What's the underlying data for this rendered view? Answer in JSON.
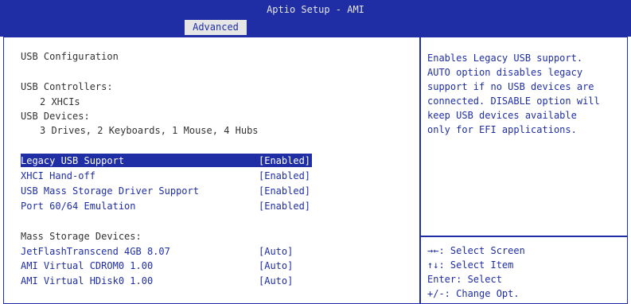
{
  "app": {
    "title": "Aptio Setup - AMI",
    "active_tab": "Advanced"
  },
  "main": {
    "section_title": "USB Configuration",
    "controllers_label": "USB Controllers:",
    "controllers_value": "2 XHCIs",
    "devices_label": "USB Devices:",
    "devices_value": "3 Drives, 2 Keyboards, 1 Mouse, 4 Hubs",
    "settings": [
      {
        "label": "Legacy USB Support",
        "value": "[Enabled]",
        "selected": true
      },
      {
        "label": "XHCI Hand-off",
        "value": "[Enabled]"
      },
      {
        "label": "USB Mass Storage Driver Support",
        "value": "[Enabled]"
      },
      {
        "label": "Port 60/64 Emulation",
        "value": "[Enabled]"
      }
    ],
    "mass_storage_label": "Mass Storage Devices:",
    "devices": [
      {
        "label": "JetFlashTranscend 4GB 8.07",
        "value": "[Auto]"
      },
      {
        "label": "AMI Virtual CDROM0 1.00",
        "value": "[Auto]"
      },
      {
        "label": "AMI Virtual HDisk0 1.00",
        "value": "[Auto]"
      }
    ]
  },
  "help": {
    "lines": [
      "Enables Legacy USB support.",
      "AUTO option disables legacy",
      "support if no USB devices are",
      "connected. DISABLE option will",
      "keep USB devices available",
      "only for EFI applications."
    ]
  },
  "keys": [
    "→←: Select Screen",
    "↑↓: Select Item",
    "Enter: Select",
    "+/-: Change Opt."
  ],
  "colors": {
    "bios_blue": "#1f2ea5",
    "text_gray": "#333333",
    "background": "#ffffff"
  }
}
